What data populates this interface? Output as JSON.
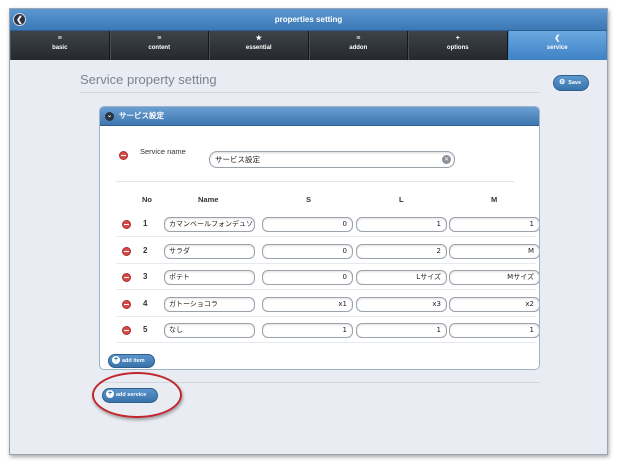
{
  "window": {
    "title": "properties setting"
  },
  "tabs": [
    {
      "label": "basic",
      "icon": "≡",
      "active": false
    },
    {
      "label": "content",
      "icon": "≡",
      "active": false
    },
    {
      "label": "essential",
      "icon": "★",
      "active": false
    },
    {
      "label": "addon",
      "icon": "≡",
      "active": false
    },
    {
      "label": "options",
      "icon": "+",
      "active": false
    },
    {
      "label": "service",
      "icon": "❮",
      "active": true
    }
  ],
  "page": {
    "title": "Service property setting",
    "save_label": "Save",
    "save_icon": "⚙"
  },
  "panel": {
    "title": "サービス設定",
    "chev_icon": "⌄",
    "service_name_label": "Service name",
    "service_name_value": "サービス設定",
    "clear_icon": "✕",
    "columns": {
      "no": "No",
      "name": "Name",
      "s": "S",
      "l": "L",
      "m": "M"
    },
    "rows": [
      {
        "no": "1",
        "name": "カマンベールフォンデュソ",
        "s": "0",
        "l": "1",
        "m": "1"
      },
      {
        "no": "2",
        "name": "サラダ",
        "s": "0",
        "l": "2",
        "m": "M"
      },
      {
        "no": "3",
        "name": "ポテト",
        "s": "0",
        "l": "Lサイズ",
        "m": "Mサイズ"
      },
      {
        "no": "4",
        "name": "ガトーショコラ",
        "s": "x1",
        "l": "x3",
        "m": "x2"
      },
      {
        "no": "5",
        "name": "なし",
        "s": "1",
        "l": "1",
        "m": "1"
      }
    ],
    "add_item_label": "add item",
    "plus_icon": "+"
  },
  "add_service_label": "add service",
  "colors": {
    "accent": "#3f82c6",
    "delete": "#d84a4a",
    "highlight": "#c0262c"
  }
}
